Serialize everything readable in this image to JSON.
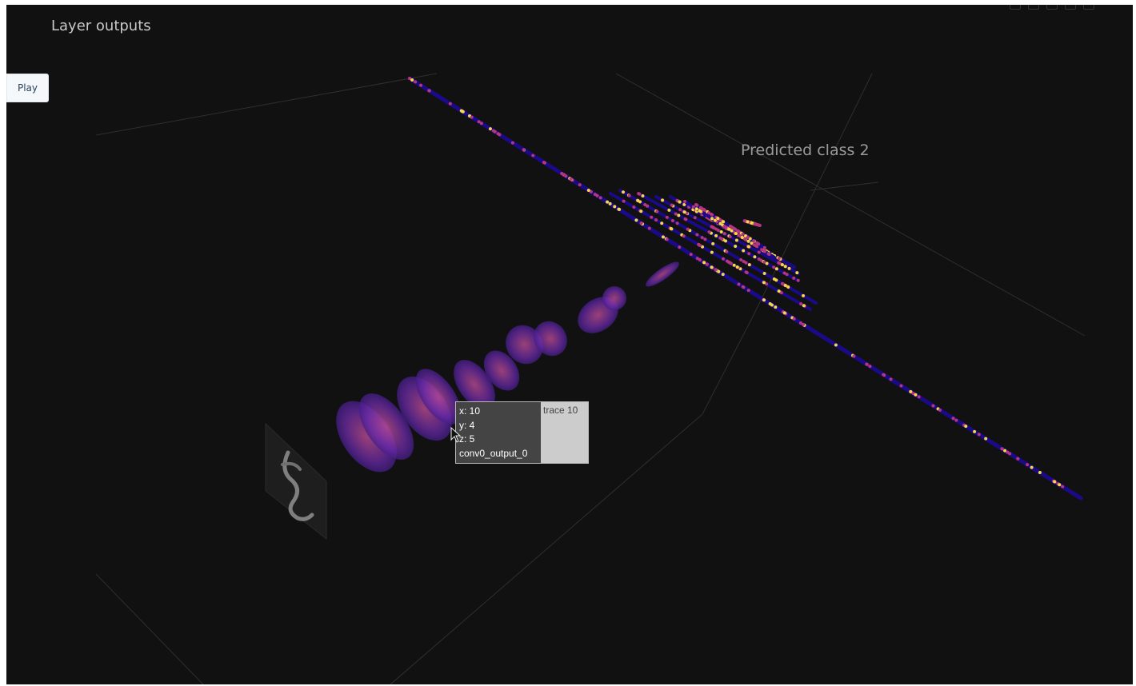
{
  "plot": {
    "title": "Layer outputs",
    "play_button": {
      "label": "Play"
    },
    "annotation": "Predicted class 2",
    "hover": {
      "x": "x: 10",
      "y": "y: 4",
      "z": "z: 5",
      "text": "conv0_output_0",
      "trace": "trace 10"
    },
    "colors": {
      "background": "#111111",
      "colorscale_low": "#1a0a8a",
      "colorscale_mid": "#b5367a",
      "colorscale_high": "#f6d746"
    }
  }
}
